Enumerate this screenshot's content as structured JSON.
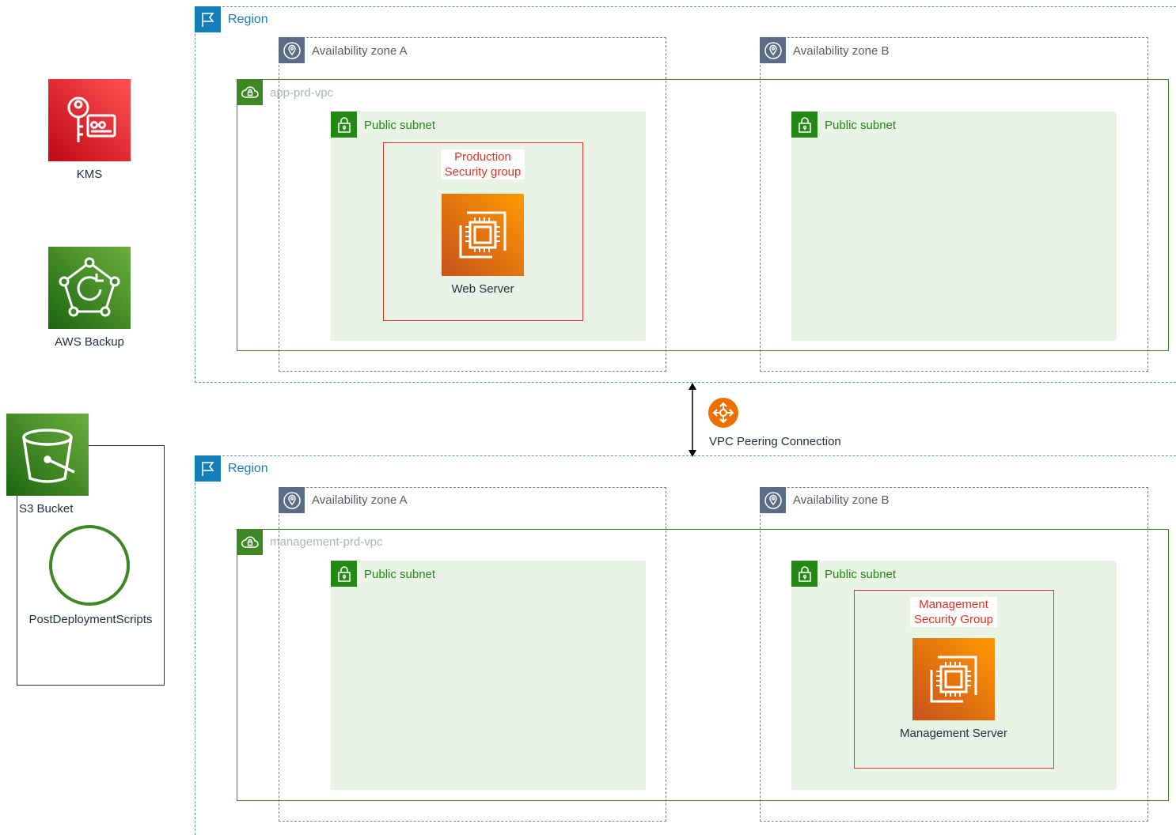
{
  "icons": {
    "region": "region-flag-icon",
    "availability_zone": "availability-zone-pin-icon",
    "vpc": "vpc-cloud-lock-icon",
    "subnet": "subnet-padlock-icon",
    "ec2": "ec2-instance-chip-icon",
    "kms": "kms-key-icon",
    "backup": "aws-backup-icon",
    "s3": "s3-bucket-icon",
    "peering": "vpc-peering-icon",
    "scripts": "circle-icon"
  },
  "colors": {
    "region": "#147eba",
    "availability_zone": "#545b64",
    "vpc": "#3f8624",
    "subnet_fill": "#e9f3e6",
    "security_group": "#dd3522",
    "ec2": "#ed7100",
    "kms": "#dd344c",
    "backup": "#3f8624",
    "peering": "#ed7100"
  },
  "services": {
    "kms": "KMS",
    "backup": "AWS Backup",
    "s3": "S3 Bucket",
    "scripts": "PostDeploymentScripts"
  },
  "top": {
    "region": "Region",
    "az_a": "Availability zone A",
    "az_b": "Availability zone B",
    "vpc": "app-prd-vpc",
    "subnet_a": "Public subnet",
    "subnet_b": "Public subnet",
    "sg_line1": "Production",
    "sg_line2": "Security group",
    "server": "Web Server"
  },
  "peering": {
    "label": "VPC Peering Connection"
  },
  "bottom": {
    "region": "Region",
    "az_a": "Availability zone A",
    "az_b": "Availability zone B",
    "vpc": "management-prd-vpc",
    "subnet_a": "Public subnet",
    "subnet_b": "Public subnet",
    "sg_line1": "Management",
    "sg_line2": "Security Group",
    "server": "Management Server"
  }
}
